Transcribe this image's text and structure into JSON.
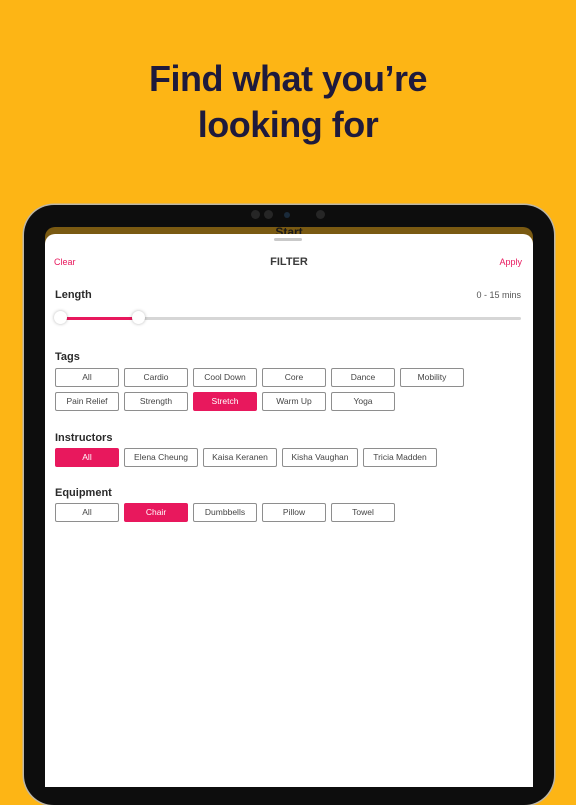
{
  "headline": {
    "line1": "Find what you’re",
    "line2": "looking for"
  },
  "background_screen_title": "Start",
  "filter": {
    "title": "FILTER",
    "clear_label": "Clear",
    "apply_label": "Apply",
    "length": {
      "label": "Length",
      "value_text": "0 - 15 mins",
      "range_min_fraction": 0.0,
      "range_max_fraction": 0.17
    },
    "tags": {
      "label": "Tags",
      "options": [
        "All",
        "Cardio",
        "Cool Down",
        "Core",
        "Dance",
        "Mobility",
        "Pain Relief",
        "Strength",
        "Stretch",
        "Warm Up",
        "Yoga"
      ],
      "selected": "Stretch"
    },
    "instructors": {
      "label": "Instructors",
      "options": [
        "All",
        "Elena Cheung",
        "Kaisa Keranen",
        "Kisha Vaughan",
        "Tricia Madden"
      ],
      "selected": "All"
    },
    "equipment": {
      "label": "Equipment",
      "options": [
        "All",
        "Chair",
        "Dumbbells",
        "Pillow",
        "Towel"
      ],
      "selected": "Chair"
    }
  },
  "colors": {
    "accent": "#E8185D",
    "background": "#FDB515",
    "headline": "#1E1A3C"
  }
}
